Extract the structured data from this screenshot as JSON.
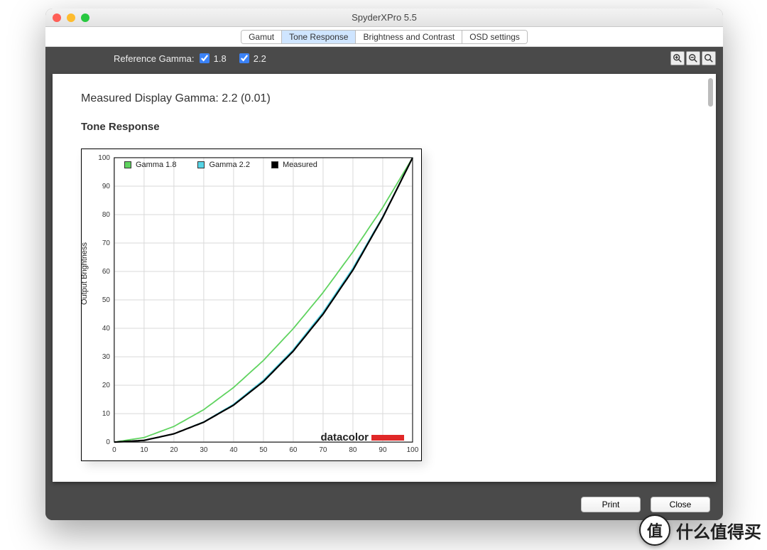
{
  "window": {
    "title": "SpyderXPro 5.5"
  },
  "tabs": [
    {
      "label": "Gamut",
      "active": false
    },
    {
      "label": "Tone Response",
      "active": true
    },
    {
      "label": "Brightness and Contrast",
      "active": false
    },
    {
      "label": "OSD settings",
      "active": false
    }
  ],
  "reference_gamma": {
    "label": "Reference Gamma:",
    "opt1": {
      "checked": true,
      "label": "1.8"
    },
    "opt2": {
      "checked": true,
      "label": "2.2"
    }
  },
  "zoom_icons": [
    "zoom-in-icon",
    "zoom-out-icon",
    "zoom-fit-icon"
  ],
  "main": {
    "measured_label": "Measured Display Gamma: 2.2 (0.01)",
    "subtitle": "Tone Response"
  },
  "chart_data": {
    "type": "line",
    "title": "",
    "xlabel": "",
    "ylabel": "Output Brightness",
    "xlim": [
      0,
      100
    ],
    "ylim": [
      0,
      100
    ],
    "xticks": [
      0,
      10,
      20,
      30,
      40,
      50,
      60,
      70,
      80,
      90,
      100
    ],
    "yticks": [
      0,
      10,
      20,
      30,
      40,
      50,
      60,
      70,
      80,
      90,
      100
    ],
    "brand": "datacolor",
    "legend": [
      {
        "name": "Gamma 1.8",
        "color": "#5fd35f"
      },
      {
        "name": "Gamma 2.2",
        "color": "#57d5e6"
      },
      {
        "name": "Measured",
        "color": "#000000"
      }
    ],
    "series": [
      {
        "name": "Gamma 1.8",
        "color": "#5fd35f",
        "x": [
          0,
          10,
          20,
          30,
          40,
          50,
          60,
          70,
          80,
          90,
          100
        ],
        "y": [
          0,
          1.6,
          5.5,
          11.4,
          19.2,
          28.7,
          39.9,
          52.6,
          66.9,
          82.5,
          100
        ]
      },
      {
        "name": "Gamma 2.2",
        "color": "#57d5e6",
        "x": [
          0,
          10,
          20,
          30,
          40,
          50,
          60,
          70,
          80,
          90,
          100
        ],
        "y": [
          0,
          0.6,
          2.9,
          7.1,
          13.3,
          21.8,
          32.5,
          45.7,
          61.2,
          79.3,
          100
        ]
      },
      {
        "name": "Measured",
        "color": "#000000",
        "x": [
          0,
          10,
          20,
          30,
          40,
          50,
          60,
          70,
          80,
          90,
          100
        ],
        "y": [
          0,
          0.6,
          2.9,
          7.0,
          13.0,
          21.3,
          32.0,
          45.0,
          60.5,
          79.0,
          100
        ]
      }
    ]
  },
  "footer": {
    "print": "Print",
    "close": "Close"
  },
  "watermark": {
    "badge": "值",
    "text": "什么值得买"
  }
}
